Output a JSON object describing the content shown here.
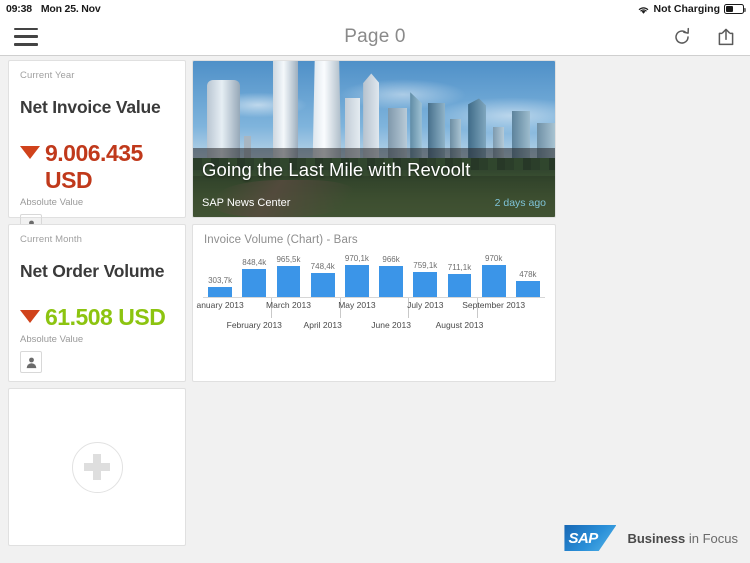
{
  "statusbar": {
    "time": "09:38",
    "date": "Mon 25. Nov",
    "battery_status": "Not Charging",
    "wifi_icon": "wifi-icon",
    "battery_icon": "battery-icon"
  },
  "navbar": {
    "menu_icon": "hamburger-menu-icon",
    "title": "Page 0",
    "refresh_icon": "refresh-icon",
    "share_icon": "share-icon"
  },
  "tiles": {
    "kpi_invoice": {
      "period": "Current Year",
      "title": "Net Invoice Value",
      "trend": "down",
      "value": "9.006.435 USD",
      "value_color": "#c0391b",
      "arrow_color": "#d0421b",
      "subtitle": "Absolute Value",
      "owner_icon": "person-icon"
    },
    "kpi_order": {
      "period": "Current Month",
      "title": "Net Order Volume",
      "trend": "down",
      "value": "61.508 USD",
      "value_color": "#8cc410",
      "arrow_color": "#d0421b",
      "subtitle": "Absolute Value",
      "owner_icon": "person-icon"
    },
    "add_tile": {
      "icon": "plus-icon",
      "label": ""
    },
    "news": {
      "title": "Going the Last Mile with Revoolt",
      "source": "SAP News Center",
      "timestamp": "2 days ago",
      "timestamp_color": "#7fc4d8"
    }
  },
  "chart_data": {
    "type": "bar",
    "title": "Invoice Volume (Chart) - Bars",
    "xlabel": "",
    "ylabel": "",
    "grid": false,
    "legend": false,
    "bar_color": "#3b95e8",
    "categories": [
      "anuary 2013",
      "February 2013",
      "March 2013",
      "April 2013",
      "May 2013",
      "June 2013",
      "July 2013",
      "August 2013",
      "September 2013",
      ""
    ],
    "value_labels": [
      "303,7k",
      "848,4k",
      "965,5k",
      "748,4k",
      "970,1k",
      "966k",
      "759,1k",
      "711,1k",
      "970k",
      "478k"
    ],
    "values": [
      303700,
      848400,
      965500,
      748400,
      970100,
      966000,
      759100,
      711100,
      970000,
      478000
    ],
    "ylim": [
      0,
      1000000
    ]
  },
  "footer": {
    "logo_text": "SAP",
    "tagline_bold": "Business",
    "tagline_rest": " in Focus"
  }
}
